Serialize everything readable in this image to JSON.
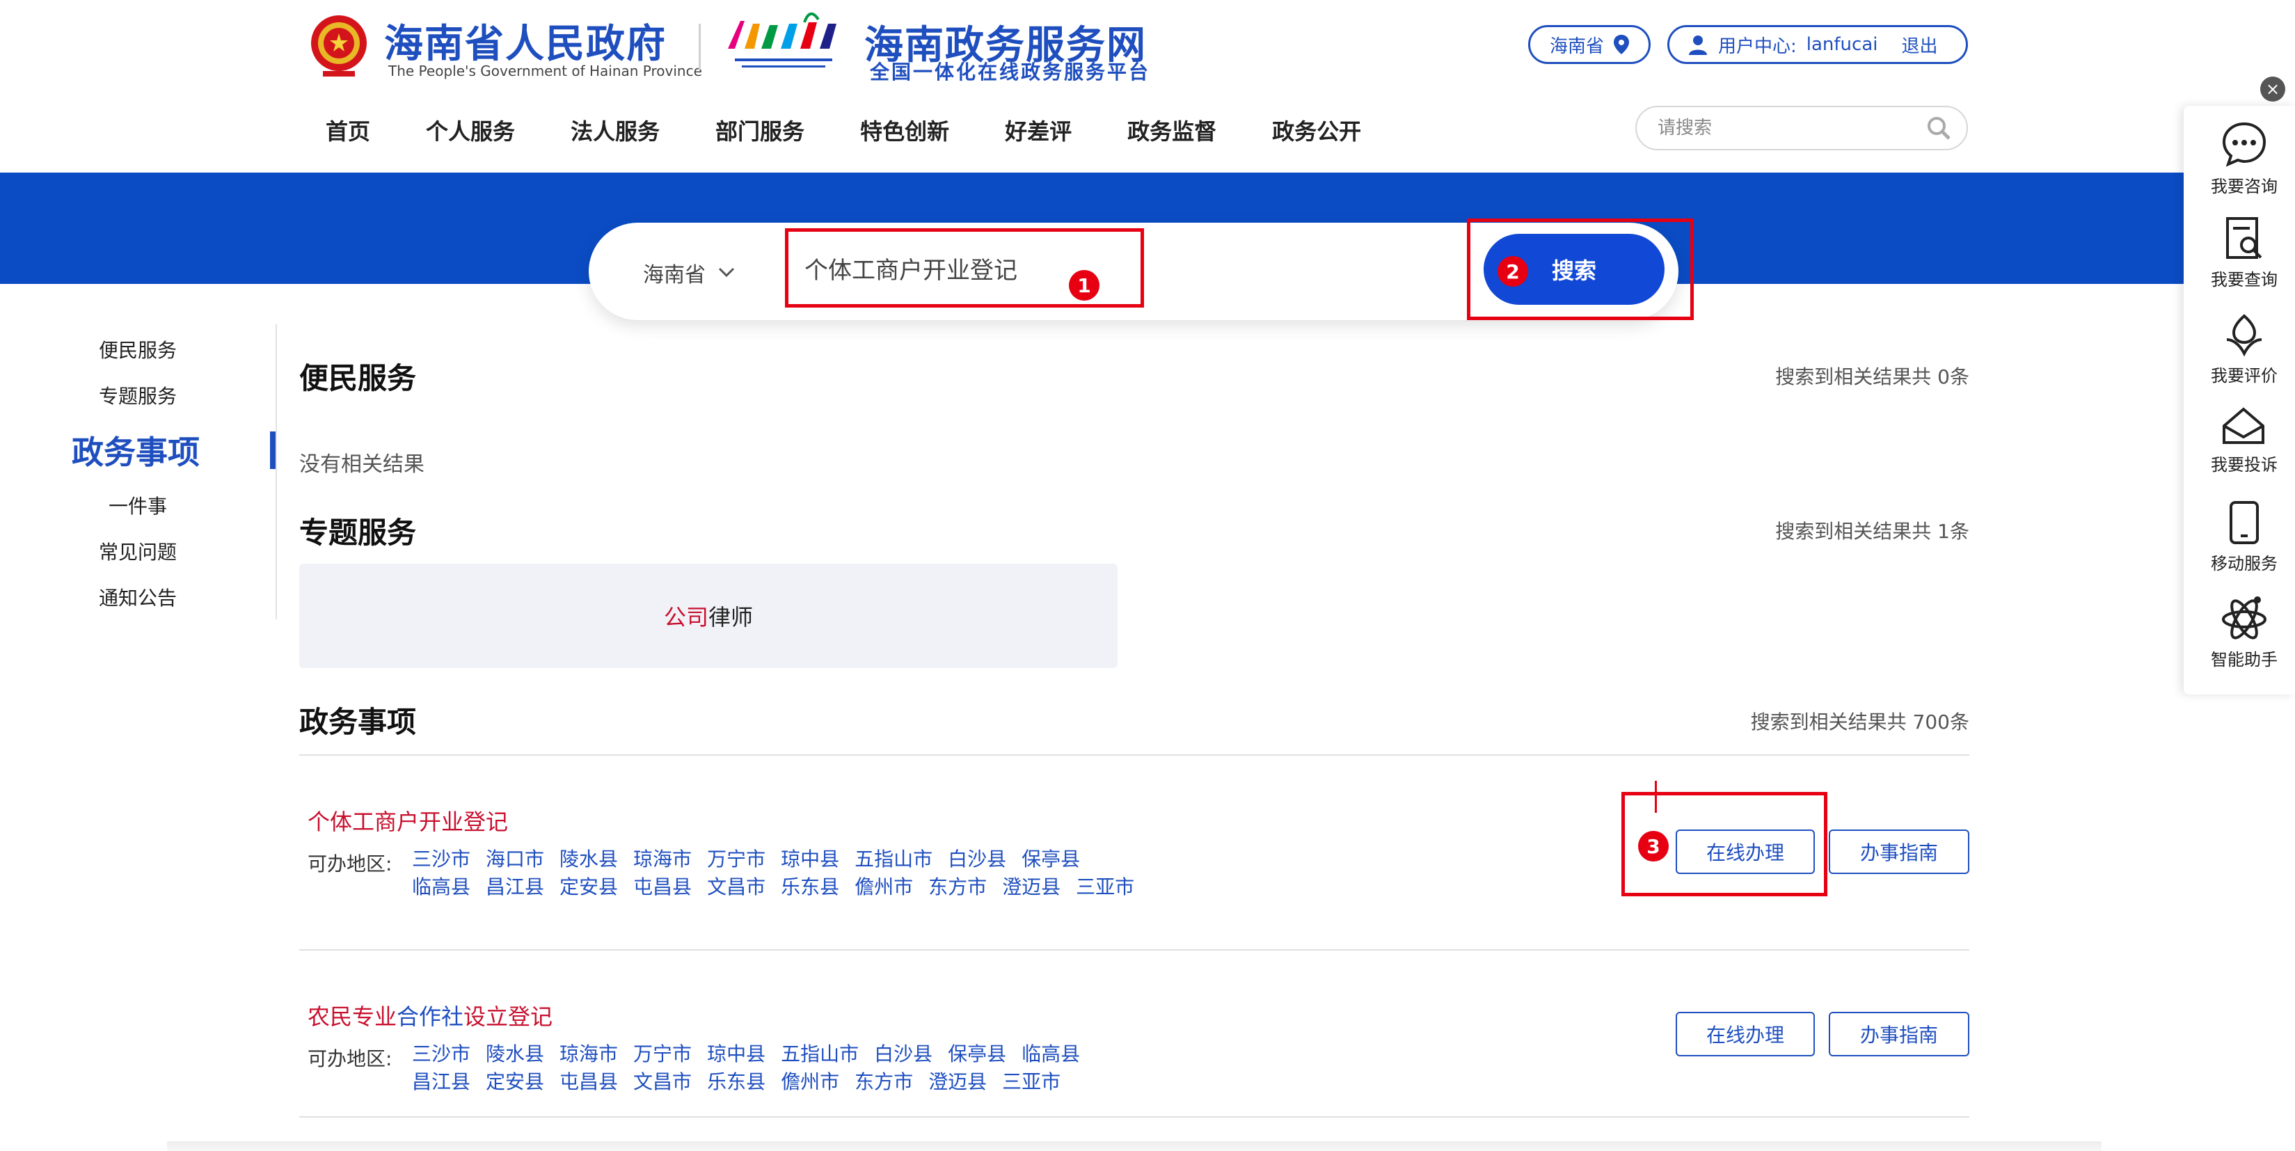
{
  "header": {
    "gov_title": "海南省人民政府",
    "gov_subtitle": "The People's Government of Hainan Province",
    "service_title": "海南政务服务网",
    "service_subtitle": "全国一体化在线政务服务平台",
    "region": "海南省",
    "user_center_label": "用户中心:",
    "username": "lanfucai",
    "logout": "退出",
    "search_placeholder": "请搜索"
  },
  "nav": [
    "首页",
    "个人服务",
    "法人服务",
    "部门服务",
    "特色创新",
    "好差评",
    "政务监督",
    "政务公开"
  ],
  "main_search": {
    "region": "海南省",
    "query": "个体工商户开业登记",
    "button": "搜索"
  },
  "annotations": [
    "1",
    "2",
    "3"
  ],
  "sidebar": {
    "items": [
      "便民服务",
      "专题服务",
      "政务事项",
      "一件事",
      "常见问题",
      "通知公告"
    ],
    "active": "政务事项"
  },
  "sections": {
    "convenience": {
      "title": "便民服务",
      "count": "搜索到相关结果共 0条",
      "empty": "没有相关结果"
    },
    "topic": {
      "title": "专题服务",
      "count": "搜索到相关结果共 1条",
      "card_highlight": "公司",
      "card_rest": "律师"
    },
    "affairs": {
      "title": "政务事项",
      "count": "搜索到相关结果共 700条"
    }
  },
  "results": [
    {
      "title": "个体工商户开业登记",
      "area_label": "可办地区:",
      "areas": [
        "三沙市",
        "海口市",
        "陵水县",
        "琼海市",
        "万宁市",
        "琼中县",
        "五指山市",
        "白沙县",
        "保亭县",
        "临高县",
        "昌江县",
        "定安县",
        "屯昌县",
        "文昌市",
        "乐东县",
        "儋州市",
        "东方市",
        "澄迈县",
        "三亚市"
      ],
      "btn_online": "在线办理",
      "btn_guide": "办事指南"
    },
    {
      "title_hl1": "农民专业",
      "title_plain": "合作社",
      "title_hl2": "设立登记",
      "area_label": "可办地区:",
      "areas": [
        "三沙市",
        "陵水县",
        "琼海市",
        "万宁市",
        "琼中县",
        "五指山市",
        "白沙县",
        "保亭县",
        "临高县",
        "昌江县",
        "定安县",
        "屯昌县",
        "文昌市",
        "乐东县",
        "儋州市",
        "东方市",
        "澄迈县",
        "三亚市"
      ],
      "btn_online": "在线办理",
      "btn_guide": "办事指南"
    }
  ],
  "float_panel": {
    "items": [
      "我要咨询",
      "我要查询",
      "我要评价",
      "我要投诉",
      "移动服务",
      "智能助手"
    ]
  },
  "colors": {
    "brand_blue": "#1f4fbf",
    "banner_blue": "#0b4cc4",
    "highlight_red": "#c8102e",
    "annotation_red": "#e60012"
  }
}
